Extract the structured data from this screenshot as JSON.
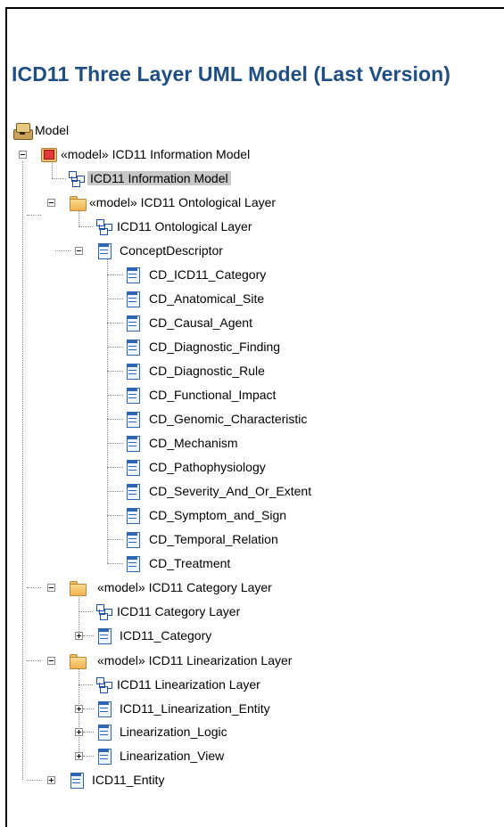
{
  "title": "ICD11 Three Layer UML Model (Last Version)",
  "tree": {
    "root": "Model",
    "info_pkg": "«model» ICD11 Information Model",
    "info_diag": "ICD11 Information Model",
    "onto_pkg": "«model» ICD11 Ontological Layer",
    "onto_diag": "ICD11 Ontological Layer",
    "concept": "ConceptDescriptor",
    "cd_items": [
      "CD_ICD11_Category",
      "CD_Anatomical_Site",
      "CD_Causal_Agent",
      "CD_Diagnostic_Finding",
      "CD_Diagnostic_Rule",
      "CD_Functional_Impact",
      "CD_Genomic_Characteristic",
      "CD_Mechanism",
      "CD_Pathophysiology",
      "CD_Severity_And_Or_Extent",
      "CD_Symptom_and_Sign",
      "CD_Temporal_Relation",
      "CD_Treatment"
    ],
    "cat_pkg": "«model» ICD11 Category Layer",
    "cat_diag": "ICD11 Category Layer",
    "cat_class": "ICD11_Category",
    "lin_pkg": "«model» ICD11 Linearization Layer",
    "lin_diag": "ICD11 Linearization Layer",
    "lin_entity": "ICD11_Linearization_Entity",
    "lin_logic": "Linearization_Logic",
    "lin_view": "Linearization_View",
    "entity": "ICD11_Entity"
  },
  "icons": {
    "root": "model-root-icon",
    "model_package": "red-model-package-icon",
    "package": "folder-package-icon",
    "diagram": "class-diagram-icon",
    "class": "class-icon"
  },
  "colors": {
    "title": "#1f4e82",
    "selection": "#c8c8c8"
  }
}
